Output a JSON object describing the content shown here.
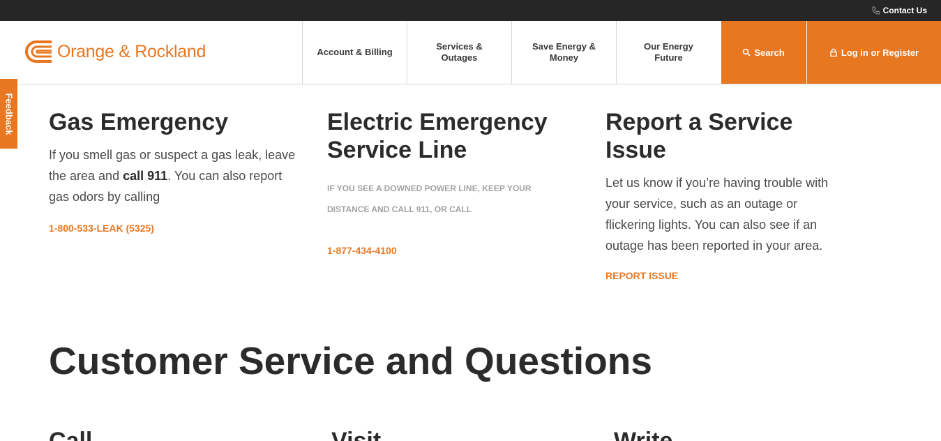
{
  "topbar": {
    "contact_label": "Contact Us"
  },
  "brand": {
    "name": "Orange & Rockland",
    "color": "#e87722"
  },
  "nav": {
    "items": [
      {
        "label": "Account & Billing"
      },
      {
        "label": "Services & Outages"
      },
      {
        "label": "Save Energy & Money"
      },
      {
        "label": "Our Energy Future"
      }
    ],
    "search_label": "Search",
    "login_label": "Log in or Register"
  },
  "feedback": {
    "label": "Feedback"
  },
  "gas": {
    "title": "Gas Emergency",
    "text_before": "If you smell gas or suspect a gas leak, leave the area and ",
    "text_bold": "call 911",
    "text_after": ". You can also report gas odors by calling",
    "phone": "1-800-533-LEAK (5325)"
  },
  "electric": {
    "title": "Electric Emergency Service Line",
    "text": "If you see a downed power line, keep your distance and call 911, or call",
    "phone": "1-877-434-4100"
  },
  "report": {
    "title": "Report a Service Issue",
    "text": "Let us know if you’re having trouble with your service, such as an outage or flickering lights. You can also see if an outage has been reported in your area.",
    "link": "REPORT ISSUE"
  },
  "customer_service": {
    "title": "Customer Service and Questions",
    "columns": [
      "Call",
      "Visit",
      "Write"
    ]
  }
}
